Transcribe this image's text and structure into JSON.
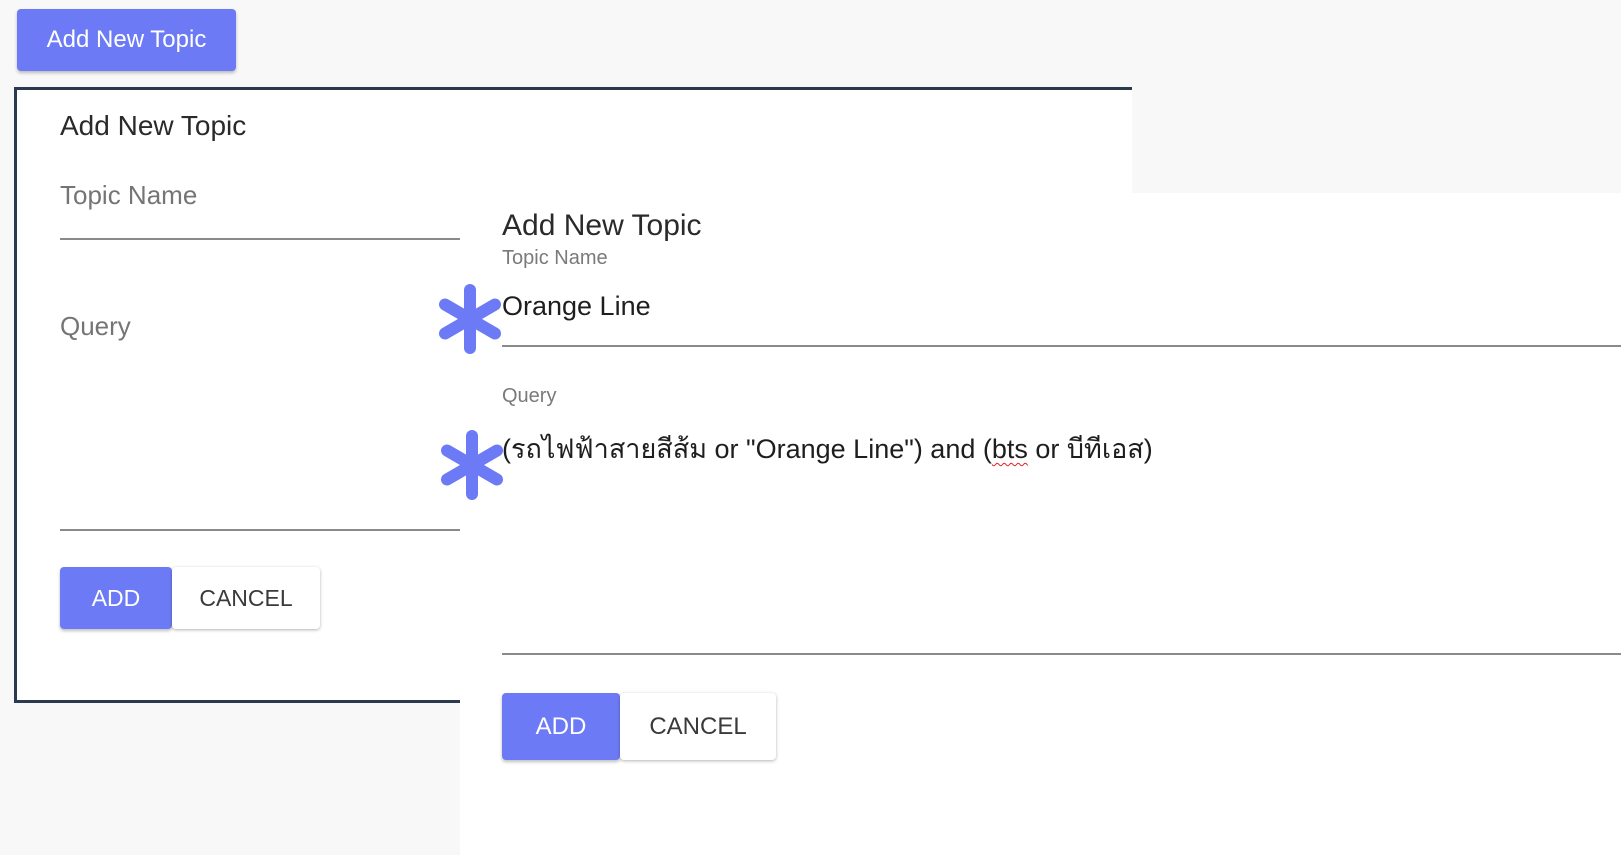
{
  "top_button": {
    "label": "Add New Topic"
  },
  "back_dialog": {
    "title": "Add New Topic",
    "topic_name_placeholder": "Topic Name",
    "query_placeholder": "Query",
    "add_label": "ADD",
    "cancel_label": "CANCEL"
  },
  "front_dialog": {
    "title": "Add New Topic",
    "topic_name_label": "Topic Name",
    "topic_name_value": "Orange Line",
    "query_label": "Query",
    "query_parts": {
      "before": "(รถไฟฟ้าสายสีส้ม or \"Orange Line\") and (",
      "misspelled": "bts",
      "after": " or บีทีเอส)"
    },
    "add_label": "ADD",
    "cancel_label": "CANCEL"
  },
  "annotations": {
    "marker_icon": "asterisk-icon",
    "marker_color": "#6c7bf5"
  },
  "colors": {
    "primary": "#6c7bf5",
    "background": "#f8f8f8",
    "dialog_border": "#2b3a4e"
  }
}
